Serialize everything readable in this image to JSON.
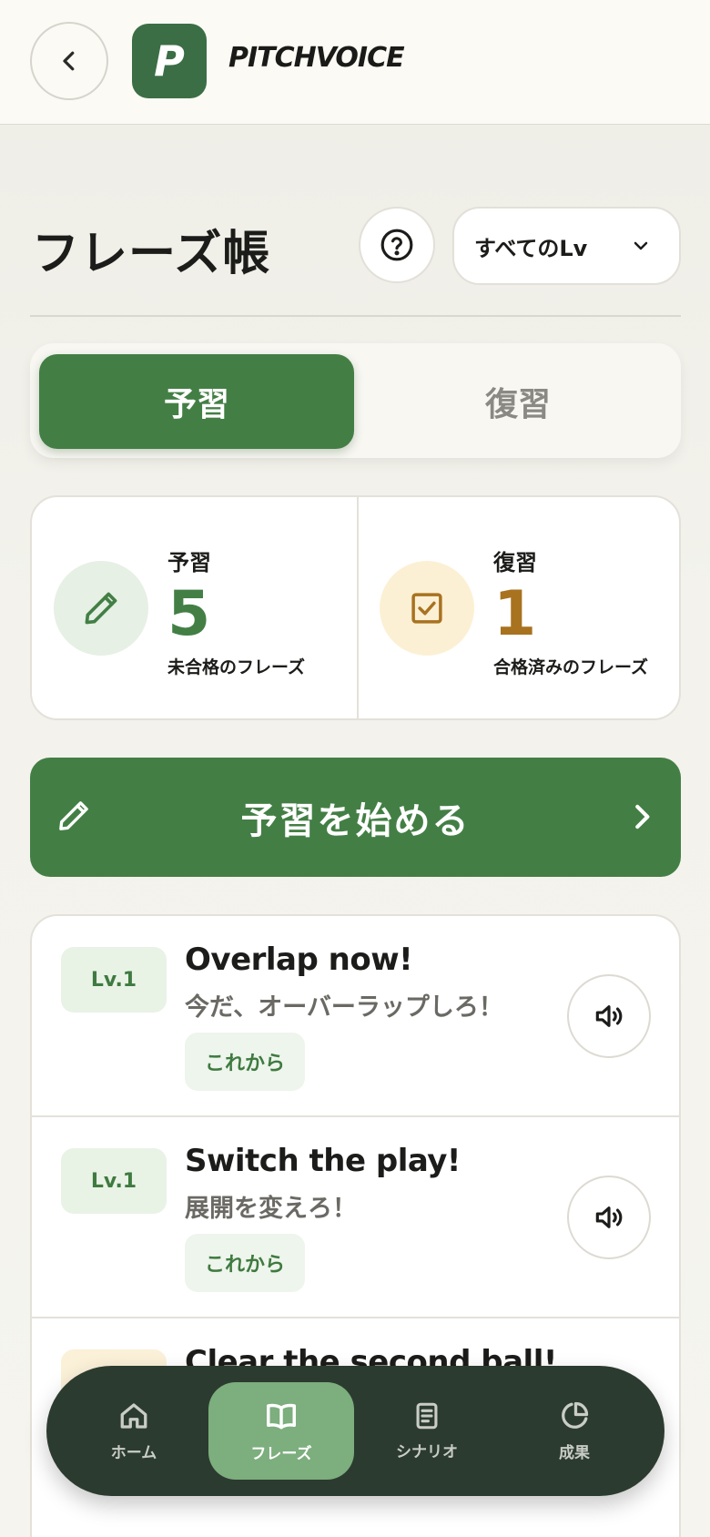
{
  "header": {
    "logo_letter": "P",
    "brand": "PITCHVOICE"
  },
  "page": {
    "title": "フレーズ帳",
    "level_filter": "すべてのLv"
  },
  "segments": {
    "preview": "予習",
    "review": "復習",
    "selected": "予習"
  },
  "stats": {
    "preview": {
      "title": "予習",
      "count": "5",
      "subtitle": "未合格のフレーズ"
    },
    "review": {
      "title": "復習",
      "count": "1",
      "subtitle": "合格済みのフレーズ"
    }
  },
  "cta": {
    "label": "予習を始める"
  },
  "phrases": [
    {
      "level": "Lv.1",
      "en": "Overlap now!",
      "ja": "今だ、オーバーラップしろ！",
      "status": "これから"
    },
    {
      "level": "Lv.1",
      "en": "Switch the play!",
      "ja": "展開を変えろ！",
      "status": "これから"
    },
    {
      "level": "",
      "en": "Clear the second ball!",
      "ja": "",
      "status": ""
    }
  ],
  "nav": {
    "items": [
      {
        "label": "ホーム",
        "icon": "home-icon"
      },
      {
        "label": "フレーズ",
        "icon": "book-icon"
      },
      {
        "label": "シナリオ",
        "icon": "document-icon"
      },
      {
        "label": "成果",
        "icon": "pie-chart-icon"
      }
    ],
    "active": "フレーズ"
  },
  "colors": {
    "primary_green": "#437f45",
    "nav_bg": "#2c3b2f",
    "nav_active": "#7dae7e",
    "review_accent": "#a8721f",
    "badge_green_bg": "#e8f3e6"
  }
}
